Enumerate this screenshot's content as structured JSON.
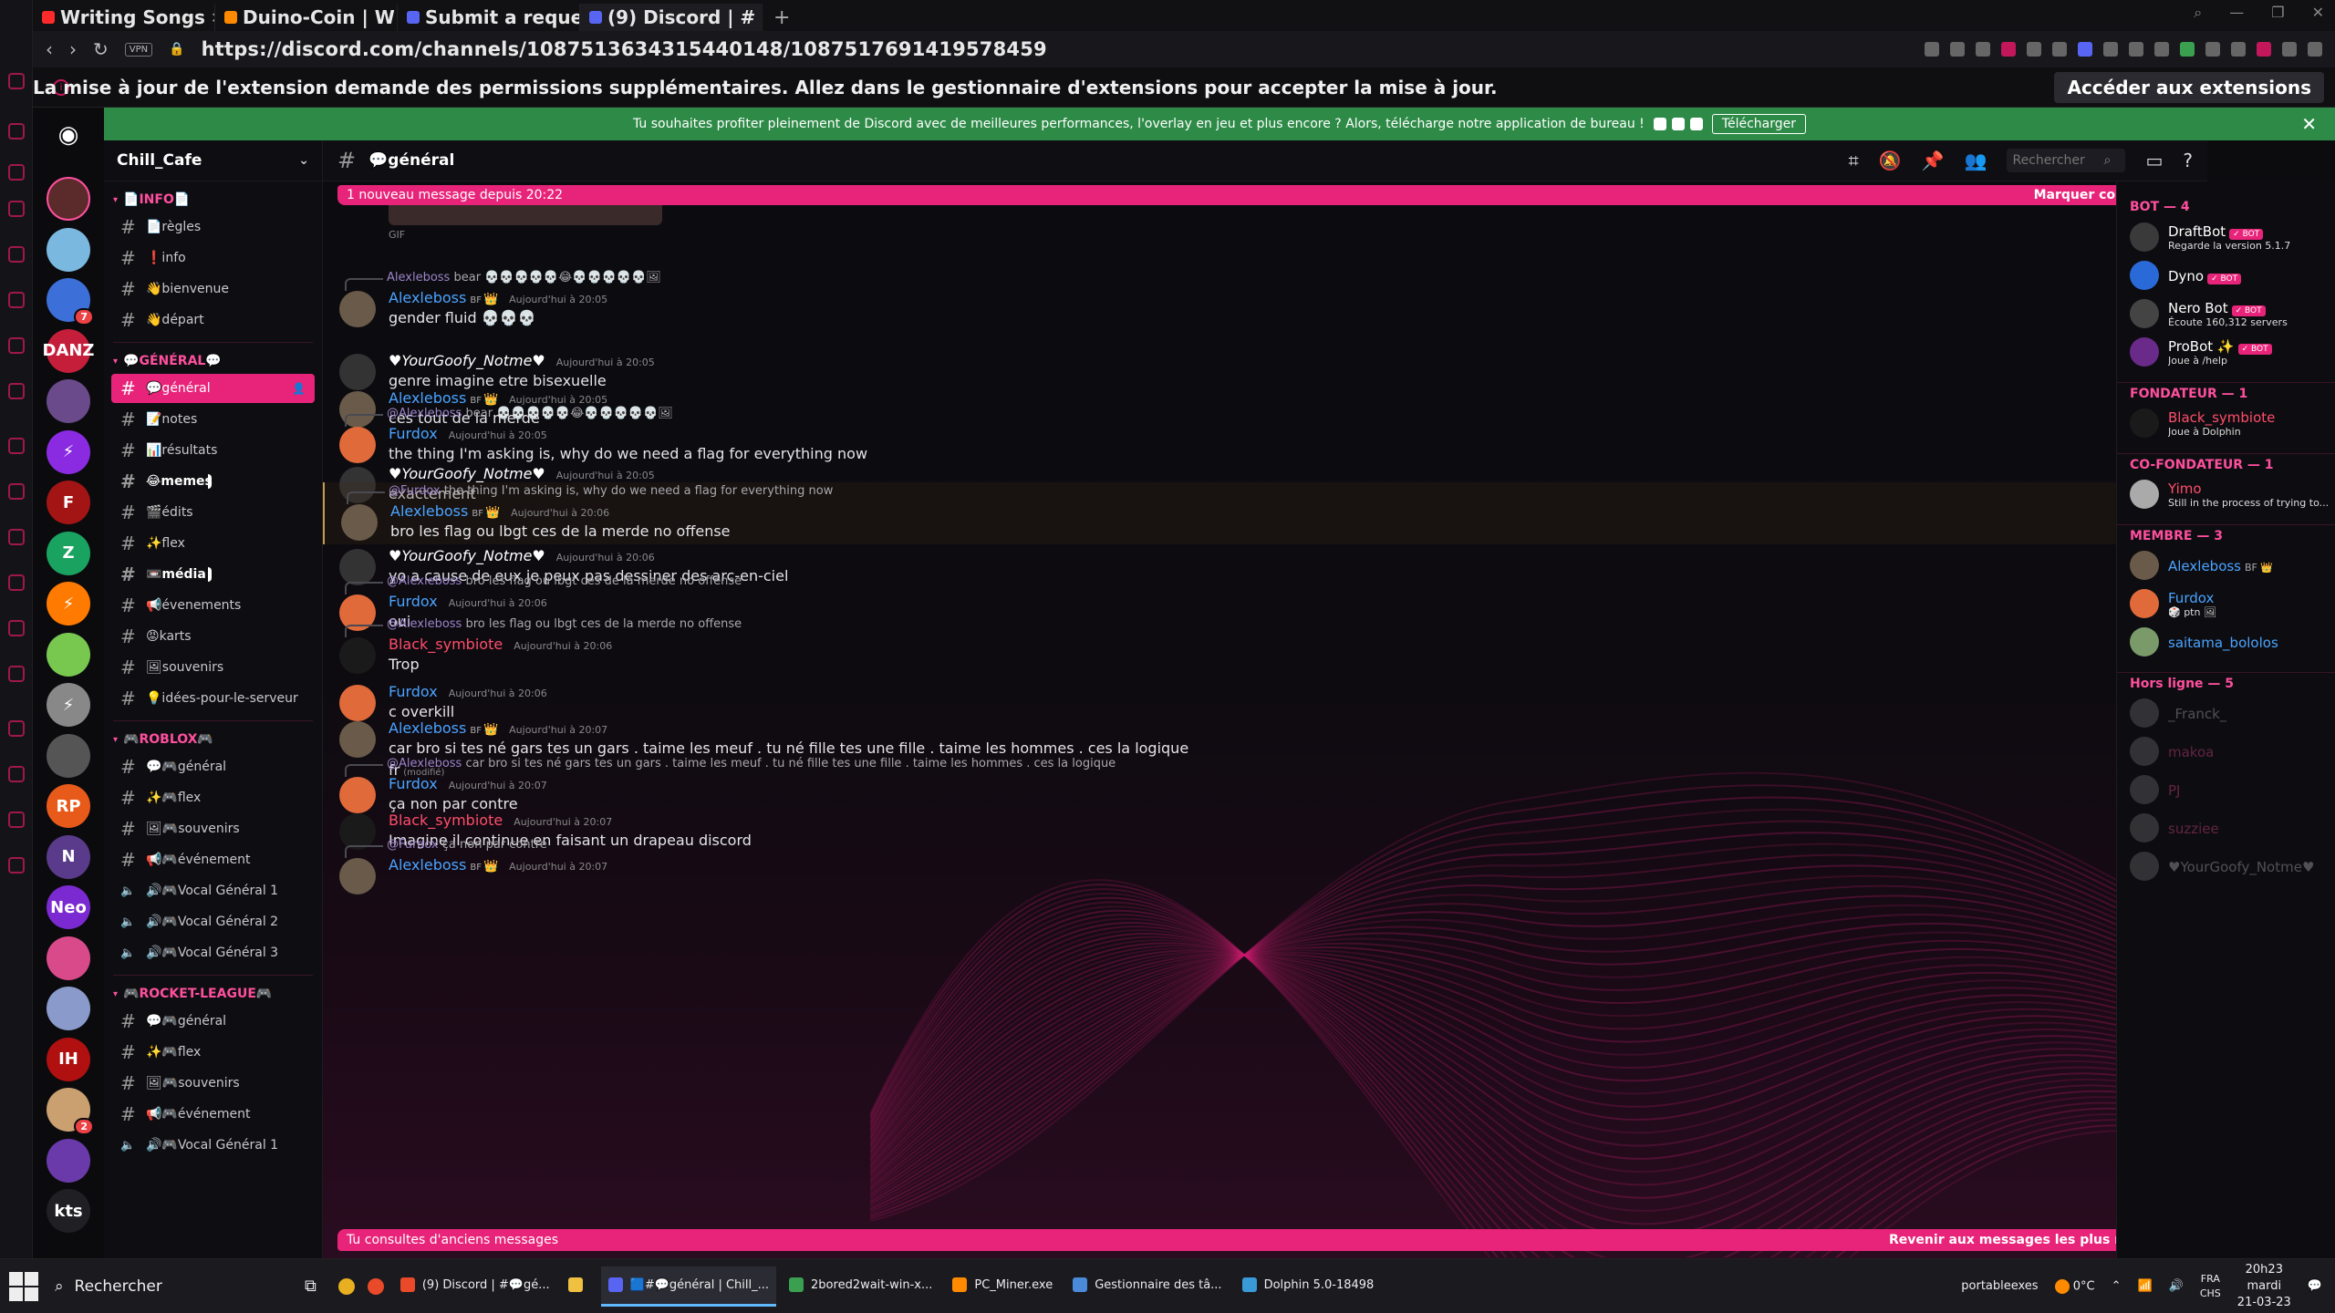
{
  "browser": {
    "tabs": [
      {
        "label": "Writing Songs",
        "color": "#ff2a2a"
      },
      {
        "label": "Duino-Coin | W",
        "color": "#ff8a00"
      },
      {
        "label": "Submit a reque",
        "color": "#5865f2"
      },
      {
        "label": "(9) Discord | #",
        "color": "#5865f2"
      }
    ],
    "new_tab": "+",
    "url": "https://discord.com/channels/1087513634315440148/1087517691419578459",
    "vpn": "VPN",
    "infobar_message": "La mise à jour de l'extension demande des permissions supplémentaires. Allez dans le gestionnaire d'extensions pour accepter la mise à jour.",
    "infobar_button": "Accéder aux extensions"
  },
  "banner": {
    "text": "Tu souhaites profiter pleinement de Discord avec de meilleures performances, l'overlay en jeu et plus encore ? Alors, télécharge notre application de bureau !",
    "button": "Télécharger"
  },
  "servers": [
    {
      "label": "",
      "color": "#5b2a2a"
    },
    {
      "label": "",
      "color": "#7ab8e0"
    },
    {
      "label": "",
      "color": "#3d6fd8",
      "badge": "7"
    },
    {
      "label": "DANZ",
      "color": "#c41e3a"
    },
    {
      "label": "",
      "color": "#6a4a8a"
    },
    {
      "label": "⚡",
      "color": "#8a2be2"
    },
    {
      "label": "F",
      "color": "#a31515"
    },
    {
      "label": "Z",
      "color": "#1aa360"
    },
    {
      "label": "⚡",
      "color": "#ff7a00"
    },
    {
      "label": "",
      "color": "#78c850"
    },
    {
      "label": "⚡",
      "color": "#888"
    },
    {
      "label": "",
      "color": "#555"
    },
    {
      "label": "RP",
      "color": "#e85a1a"
    },
    {
      "label": "N",
      "color": "#5a3a8a"
    },
    {
      "label": "Neo",
      "color": "#7a2ad0"
    },
    {
      "label": "",
      "color": "#d84a8a"
    },
    {
      "label": "",
      "color": "#8a9aca"
    },
    {
      "label": "IH",
      "color": "#b01010"
    },
    {
      "label": "",
      "color": "#caa070",
      "badge": "2"
    },
    {
      "label": "",
      "color": "#6a3aaa"
    },
    {
      "label": "kts",
      "color": "#202024"
    }
  ],
  "guild": {
    "name": "Chill_Cafe",
    "categories": [
      {
        "name": "📄INFO📄",
        "channels": [
          {
            "name": "📄règles",
            "type": "text"
          },
          {
            "name": "❗info",
            "type": "text"
          },
          {
            "name": "👋bienvenue",
            "type": "text"
          },
          {
            "name": "👋départ",
            "type": "text"
          }
        ]
      },
      {
        "name": "💬Général💬",
        "channels": [
          {
            "name": "💬général",
            "type": "text",
            "active": true
          },
          {
            "name": "📝notes",
            "type": "text"
          },
          {
            "name": "📊résultats",
            "type": "text"
          },
          {
            "name": "😂memes",
            "type": "text",
            "unread": true
          },
          {
            "name": "🎬édits",
            "type": "text"
          },
          {
            "name": "✨flex",
            "type": "text"
          },
          {
            "name": "📼média",
            "type": "text",
            "unread": true
          },
          {
            "name": "📢évenements",
            "type": "text"
          },
          {
            "name": "😡karts",
            "type": "text"
          },
          {
            "name": "🖼souvenirs",
            "type": "text"
          },
          {
            "name": "💡idées-pour-le-serveur",
            "type": "text"
          }
        ]
      },
      {
        "name": "🎮ROBLOX🎮",
        "channels": [
          {
            "name": "💬🎮général",
            "type": "text"
          },
          {
            "name": "✨🎮flex",
            "type": "text"
          },
          {
            "name": "🖼🎮souvenirs",
            "type": "text"
          },
          {
            "name": "📢🎮événement",
            "type": "text"
          },
          {
            "name": "🔊🎮Vocal Général 1",
            "type": "voice"
          },
          {
            "name": "🔊🎮Vocal Général 2",
            "type": "voice"
          },
          {
            "name": "🔊🎮Vocal Général 3",
            "type": "voice"
          }
        ]
      },
      {
        "name": "🎮ROCKET-LEAGUE🎮",
        "channels": [
          {
            "name": "💬🎮général",
            "type": "text"
          },
          {
            "name": "✨🎮flex",
            "type": "text"
          },
          {
            "name": "🖼🎮souvenirs",
            "type": "text"
          },
          {
            "name": "📢🎮événement",
            "type": "text"
          },
          {
            "name": "🔊🎮Vocal Général 1",
            "type": "voice"
          }
        ]
      }
    ]
  },
  "channel_header": {
    "name": "💬général",
    "search_placeholder": "Rechercher"
  },
  "chat": {
    "new_messages_bar": "1 nouveau message depuis 20:22",
    "mark_read": "Marquer comme lu",
    "old_messages_bar": "Tu consultes d'anciens messages",
    "jump_recent": "Revenir aux messages les plus récents",
    "gif_label": "GIF",
    "messages": [
      {
        "reply": {
          "author": "Alexleboss",
          "text": "bear 💀💀💀💀💀😂💀💀💀💀💀🖼"
        },
        "author": "Alexleboss",
        "class": "c-alex",
        "tag": "BF",
        "crown": true,
        "time": "Aujourd'hui à 20:05",
        "text": "gender fluid 💀💀💀",
        "avatar": "#6a5a4a"
      },
      {
        "author": "♥YourGoofy_Notme♥",
        "class": "c-goofy",
        "time": "Aujourd'hui à 20:05",
        "text": "genre imagine etre bisexuelle",
        "avatar": "#333"
      },
      {
        "author": "Alexleboss",
        "class": "c-alex",
        "tag": "BF",
        "crown": true,
        "time": "Aujourd'hui à 20:05",
        "text": "ces tout de la merde",
        "avatar": "#6a5a4a"
      },
      {
        "reply": {
          "author": "@Alexleboss",
          "text": "bear 💀💀💀💀💀😂💀💀💀💀💀🖼"
        },
        "author": "Furdox",
        "class": "c-fur",
        "time": "Aujourd'hui à 20:05",
        "text": "the thing I'm asking is, why do we need a flag for everything now",
        "avatar": "#e06a3a"
      },
      {
        "author": "♥YourGoofy_Notme♥",
        "class": "c-goofy",
        "time": "Aujourd'hui à 20:05",
        "text": "exactement",
        "avatar": "#333"
      },
      {
        "reply": {
          "author": "@Furdox",
          "text": "the thing I'm asking is, why do we need a flag for everything now"
        },
        "author": "Alexleboss",
        "class": "c-alex",
        "tag": "BF",
        "crown": true,
        "time": "Aujourd'hui à 20:06",
        "text": "bro les flag ou lbgt ces de la merde no offense",
        "avatar": "#6a5a4a",
        "highlight": true
      },
      {
        "author": "♥YourGoofy_Notme♥",
        "class": "c-goofy",
        "time": "Aujourd'hui à 20:06",
        "text": "yo a cause de eux je peux pas dessiner des arc-en-ciel",
        "avatar": "#333"
      },
      {
        "reply": {
          "author": "@Alexleboss",
          "text": "bro les flag ou lbgt ces de la merde no offense"
        },
        "author": "Furdox",
        "class": "c-fur",
        "time": "Aujourd'hui à 20:06",
        "text": "oui",
        "avatar": "#e06a3a"
      },
      {
        "reply": {
          "author": "@Alexleboss",
          "text": "bro les flag ou lbgt ces de la merde no offense"
        },
        "author": "Black_symbiote",
        "class": "c-black",
        "time": "Aujourd'hui à 20:06",
        "text": "Trop",
        "avatar": "#1a1a1a"
      },
      {
        "author": "Furdox",
        "class": "c-fur",
        "time": "Aujourd'hui à 20:06",
        "text": "c overkill",
        "avatar": "#e06a3a"
      },
      {
        "author": "Alexleboss",
        "class": "c-alex",
        "tag": "BF",
        "crown": true,
        "time": "Aujourd'hui à 20:07",
        "text": "car bro si tes né gars tes un gars . taime les meuf . tu né fille tes une fille . taime les hommes . ces la logique",
        "text2": "fr",
        "edited": "(modifié)",
        "avatar": "#6a5a4a"
      },
      {
        "reply": {
          "author": "@Alexleboss",
          "text": "car bro si tes né gars tes un gars . taime les meuf . tu né fille tes une fille . taime les hommes . ces la logique"
        },
        "author": "Furdox",
        "class": "c-fur",
        "time": "Aujourd'hui à 20:07",
        "text": "ça non par contre",
        "avatar": "#e06a3a"
      },
      {
        "author": "Black_symbiote",
        "class": "c-black",
        "time": "Aujourd'hui à 20:07",
        "text": "Imagine il continue en faisant un drapeau discord",
        "avatar": "#1a1a1a"
      },
      {
        "reply": {
          "author": "@Furdox",
          "text": "ça non par contre"
        },
        "author": "Alexleboss",
        "class": "c-alex",
        "tag": "BF",
        "crown": true,
        "time": "Aujourd'hui à 20:07",
        "text": "",
        "avatar": "#6a5a4a"
      }
    ]
  },
  "members": {
    "groups": [
      {
        "title": "BOT — 4",
        "items": [
          {
            "name": "DraftBot",
            "bot": true,
            "status": "Regarde la version 5.1.7",
            "color": "#fff",
            "avatar": "#3a3a3a"
          },
          {
            "name": "Dyno",
            "bot": true,
            "status": "",
            "color": "#fff",
            "avatar": "#2a6ad8"
          },
          {
            "name": "Nero Bot",
            "bot": true,
            "status": "Écoute 160,312 servers",
            "color": "#fff",
            "avatar": "#444"
          },
          {
            "name": "ProBot ✨",
            "bot": true,
            "status": "Joue à /help",
            "color": "#fff",
            "avatar": "#6a2a8a"
          }
        ]
      },
      {
        "title": "FONDATEUR — 1",
        "items": [
          {
            "name": "Black_symbiote",
            "status": "Joue à Dolphin",
            "color": "#ff4d6a",
            "avatar": "#1a1a1a"
          }
        ]
      },
      {
        "title": "CO-FONDATEUR — 1",
        "items": [
          {
            "name": "Yimo",
            "status": "Still in the process of trying to...",
            "color": "#ff4d6a",
            "avatar": "#aaa"
          }
        ]
      },
      {
        "title": "MEMBRE — 3",
        "items": [
          {
            "name": "Alexleboss",
            "status": "",
            "color": "#4aa3ff",
            "avatar": "#6a5a4a",
            "tag": "BF 👑"
          },
          {
            "name": "Furdox",
            "status": "🎲 ptn 🖼",
            "color": "#4aa3ff",
            "avatar": "#e06a3a"
          },
          {
            "name": "saitama_bololos",
            "status": "",
            "color": "#4aa3ff",
            "avatar": "#7a9a6a"
          }
        ]
      },
      {
        "title": "Hors ligne — 5",
        "offline": true,
        "items": [
          {
            "name": "_Franck_",
            "status": "",
            "color": "#ccc",
            "avatar": "#777"
          },
          {
            "name": "makoa",
            "status": "",
            "color": "#ff4d9e",
            "avatar": "#777"
          },
          {
            "name": "PJ",
            "status": "",
            "color": "#ff4d9e",
            "avatar": "#777"
          },
          {
            "name": "suzziee",
            "status": "",
            "color": "#ff4d9e",
            "avatar": "#777"
          },
          {
            "name": "♥YourGoofy_Notme♥",
            "status": "",
            "color": "#ccc",
            "avatar": "#777"
          }
        ]
      }
    ]
  },
  "taskbar": {
    "search": "Rechercher",
    "apps": [
      {
        "label": "(9) Discord | #💬gé...",
        "color": "#e84a2a"
      },
      {
        "label": "",
        "color": "#f0c040"
      },
      {
        "label": "🟦#💬général | Chill_...",
        "color": "#5865f2",
        "active": true
      },
      {
        "label": "2bored2wait-win-x...",
        "color": "#3aa050"
      },
      {
        "label": "PC_Miner.exe",
        "color": "#ff8a00"
      },
      {
        "label": "Gestionnaire des tâ...",
        "color": "#4a8ad8"
      },
      {
        "label": "Dolphin 5.0-18498",
        "color": "#3a9ad8"
      }
    ],
    "tray_user": "portableexes",
    "weather": "0°C",
    "lang": "FRA",
    "lang2": "CHS",
    "time": "20h23",
    "day": "mardi",
    "date": "21-03-23"
  }
}
